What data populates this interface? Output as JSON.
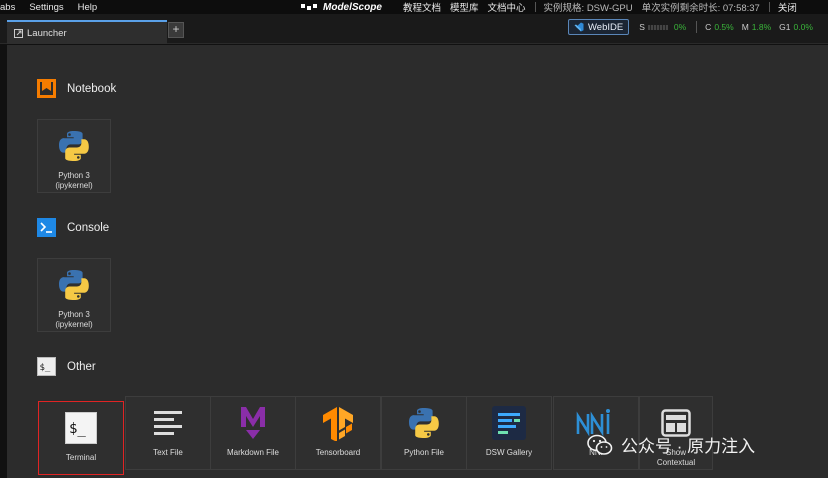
{
  "menubar": {
    "items": [
      "abs",
      "Settings",
      "Help"
    ],
    "brand": "ModelScope",
    "links": [
      "教程文档",
      "模型库",
      "文档中心"
    ],
    "instance_spec": "实例规格: DSW-GPU",
    "remaining_time": "单次实例剩余时长: 07:58:37",
    "close": "关闭"
  },
  "tabbar": {
    "tab_label": "Launcher",
    "plus": "+",
    "webide_label": "WebIDE",
    "stats": {
      "s_label": "S",
      "s_value": "0%",
      "c_label": "C",
      "c_value": "0.5%",
      "m_label": "M",
      "m_value": "1.8%",
      "g_label": "G1",
      "g_value": "0.0%"
    }
  },
  "launcher": {
    "notebook": {
      "title": "Notebook",
      "cards": [
        {
          "label1": "Python 3",
          "label2": "(ipykernel)"
        }
      ]
    },
    "console": {
      "title": "Console",
      "cards": [
        {
          "label1": "Python 3",
          "label2": "(ipykernel)"
        }
      ]
    },
    "other": {
      "title": "Other",
      "cards": [
        {
          "label": "Terminal"
        },
        {
          "label": "Text File"
        },
        {
          "label": "Markdown File"
        },
        {
          "label": "Tensorboard"
        },
        {
          "label": "Python File"
        },
        {
          "label": "DSW Gallery"
        },
        {
          "label": "NNI"
        },
        {
          "label1": "Show",
          "label2": "Contextual"
        }
      ]
    }
  },
  "watermark": "公众号 · 原力注入",
  "colors": {
    "accent_blue": "#5aa0e8",
    "notebook_orange": "#f57c00",
    "console_blue": "#1e88e5",
    "status_green": "#3ab53a",
    "selection_red": "#e02424"
  }
}
